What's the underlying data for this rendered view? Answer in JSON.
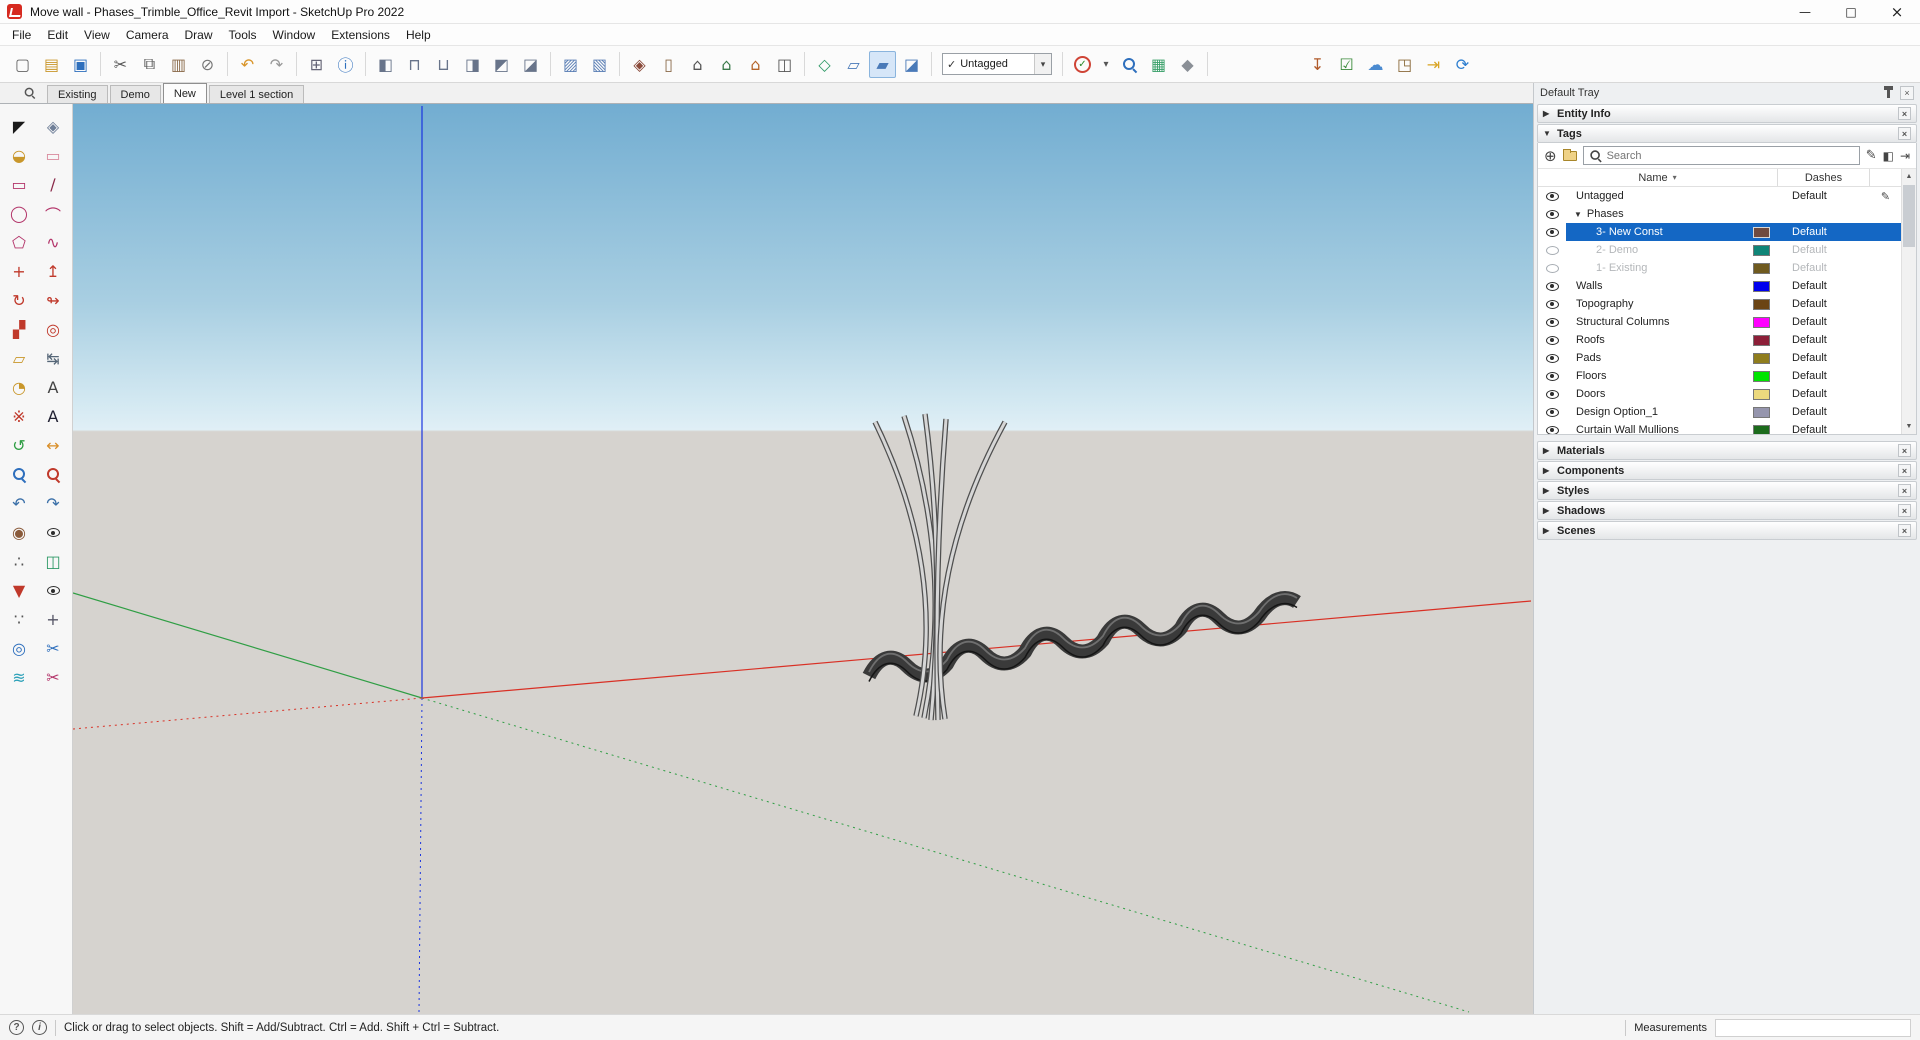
{
  "window": {
    "title": "Move wall - Phases_Trimble_Office_Revit Import - SketchUp Pro 2022"
  },
  "icons": {
    "minimize": "—",
    "maximize": "□",
    "window_close": "×",
    "collapsed_arrow": "▶",
    "expanded_arrow": "▼",
    "close": "×",
    "dropdown_arrow": "▾",
    "sort_chevron": "▾",
    "check": "✓",
    "pencil": "✎",
    "add": "⊕",
    "scroll_up": "▲",
    "scroll_down": "▼",
    "help": "?",
    "info": "i"
  },
  "menubar": {
    "items": [
      "File",
      "Edit",
      "View",
      "Camera",
      "Draw",
      "Tools",
      "Window",
      "Extensions",
      "Help"
    ]
  },
  "toolbar": {
    "tag_dropdown": {
      "value": "Untagged"
    },
    "groups": [
      [
        {
          "name": "new",
          "glyph": "▢",
          "color": "#666"
        },
        {
          "name": "open",
          "glyph": "▤",
          "color": "#c9972b"
        },
        {
          "name": "save",
          "glyph": "▣",
          "color": "#2e6fbd"
        }
      ],
      [
        {
          "name": "cut",
          "glyph": "✂",
          "color": "#555"
        },
        {
          "name": "copy",
          "glyph": "⧉",
          "color": "#555"
        },
        {
          "name": "paste",
          "glyph": "▥",
          "color": "#8a6a4a"
        },
        {
          "name": "erase",
          "glyph": "⊘",
          "color": "#777"
        }
      ],
      [
        {
          "name": "undo",
          "glyph": "↶",
          "color": "#d9952a"
        },
        {
          "name": "redo",
          "glyph": "↷",
          "color": "#999"
        }
      ],
      [
        {
          "name": "print",
          "glyph": "⊞",
          "color": "#667"
        },
        {
          "name": "model-info",
          "glyph": "ⓘ",
          "color": "#2e6fbd"
        }
      ],
      [
        {
          "name": "outer-shell",
          "glyph": "◧",
          "color": "#68748a"
        },
        {
          "name": "intersect",
          "glyph": "⊓",
          "color": "#68748a"
        },
        {
          "name": "union",
          "glyph": "⊔",
          "color": "#68748a"
        },
        {
          "name": "subtract",
          "glyph": "◨",
          "color": "#68748a"
        },
        {
          "name": "trim",
          "glyph": "◩",
          "color": "#68748a"
        },
        {
          "name": "split",
          "glyph": "◪",
          "color": "#68748a"
        }
      ],
      [
        {
          "name": "x-ray",
          "glyph": "▨",
          "color": "#5b7fb5"
        },
        {
          "name": "back-edges",
          "glyph": "▧",
          "color": "#5b7fb5"
        }
      ],
      [
        {
          "name": "component",
          "glyph": "◈",
          "color": "#8a4a3a"
        },
        {
          "name": "door",
          "glyph": "▯",
          "color": "#8a6a4a"
        },
        {
          "name": "home",
          "glyph": "⌂",
          "color": "#555"
        },
        {
          "name": "share-model",
          "glyph": "⌂",
          "color": "#3a7a4a"
        },
        {
          "name": "extension-warehouse",
          "glyph": "⌂",
          "color": "#b5652a"
        },
        {
          "name": "3d-warehouse",
          "glyph": "◫",
          "color": "#555"
        }
      ],
      [
        {
          "name": "section-plane",
          "glyph": "◇",
          "color": "#2f9a67"
        },
        {
          "name": "display-section-planes",
          "glyph": "▱",
          "color": "#4a7ab8"
        },
        {
          "name": "display-section-cuts",
          "glyph": "▰",
          "color": "#4a7ab8",
          "pressed": true
        },
        {
          "name": "display-section-fill",
          "glyph": "◪",
          "color": "#4a7ab8"
        }
      ],
      [
        {
          "type": "combo",
          "name": "tag-filter"
        }
      ],
      [
        {
          "type": "circle-check",
          "name": "check-validity"
        },
        {
          "name": "classifier-dropdown",
          "glyph": "▾",
          "color": "#555",
          "small": true
        },
        {
          "type": "mag",
          "name": "zoom-selection",
          "color": "#2e6fbd"
        },
        {
          "name": "generate-report",
          "glyph": "▦",
          "color": "#3aa06a"
        },
        {
          "name": "classifier-tag",
          "glyph": "◆",
          "color": "#8a8f96"
        }
      ],
      [
        {
          "name": "import",
          "glyph": "↧",
          "color": "#b05a2a"
        },
        {
          "name": "check-model",
          "glyph": "☑",
          "color": "#3a8a3a"
        },
        {
          "name": "publish-trimble-connect",
          "glyph": "☁",
          "color": "#4a8ad0"
        },
        {
          "name": "share-3d-warehouse",
          "glyph": "◳",
          "color": "#8a6a3a"
        },
        {
          "name": "send-to-layout",
          "glyph": "⇥",
          "color": "#d9a422"
        },
        {
          "name": "refresh-model",
          "glyph": "⟳",
          "color": "#2e7fd0"
        }
      ]
    ]
  },
  "scene_tabs": {
    "tabs": [
      {
        "label": "Existing",
        "active": false
      },
      {
        "label": "Demo",
        "active": false
      },
      {
        "label": "New",
        "active": true
      },
      {
        "label": "Level 1 section",
        "active": false
      }
    ]
  },
  "left_toolbar": {
    "tools": [
      {
        "name": "select",
        "glyph": "◤",
        "color": "#1a1a1a"
      },
      {
        "name": "make-component",
        "glyph": "◈",
        "color": "#6f7f98"
      },
      {
        "name": "paint-bucket",
        "glyph": "◒",
        "color": "#c9972b"
      },
      {
        "name": "eraser",
        "glyph": "▭",
        "color": "#d98a9d"
      },
      {
        "name": "rectangle",
        "glyph": "▭",
        "color": "#b3356a"
      },
      {
        "name": "line",
        "glyph": "∕",
        "color": "#8a2a4a"
      },
      {
        "name": "circle",
        "glyph": "◯",
        "color": "#b3356a"
      },
      {
        "name": "arc",
        "glyph": "⌒",
        "color": "#b3356a"
      },
      {
        "name": "polygon",
        "glyph": "⬠",
        "color": "#b3356a"
      },
      {
        "name": "freehand",
        "glyph": "∿",
        "color": "#b3356a"
      },
      {
        "name": "move",
        "glyph": "+",
        "color": "#c0392b"
      },
      {
        "name": "push-pull",
        "glyph": "↥",
        "color": "#c0392b"
      },
      {
        "name": "rotate",
        "glyph": "↻",
        "color": "#c0392b"
      },
      {
        "name": "follow-me",
        "glyph": "↬",
        "color": "#c0392b"
      },
      {
        "name": "scale",
        "glyph": "▞",
        "color": "#c0392b"
      },
      {
        "name": "offset",
        "glyph": "◎",
        "color": "#c0392b"
      },
      {
        "name": "tape-measure",
        "glyph": "▱",
        "color": "#c9972b"
      },
      {
        "name": "dimension",
        "glyph": "↹",
        "color": "#556677"
      },
      {
        "name": "protractor",
        "glyph": "◔",
        "color": "#c9972b"
      },
      {
        "name": "text",
        "glyph": "A",
        "color": "#444"
      },
      {
        "name": "axes",
        "glyph": "※",
        "color": "#c0392b"
      },
      {
        "name": "3d-text",
        "glyph": "A",
        "color": "#223"
      },
      {
        "name": "orbit",
        "glyph": "↺",
        "color": "#2f9e44"
      },
      {
        "name": "pan",
        "glyph": "↔",
        "color": "#d98f2a"
      },
      {
        "name": "zoom",
        "glyph": "@MAG",
        "color": "#2e6fbd"
      },
      {
        "name": "zoom-extents",
        "glyph": "@MAG",
        "color": "#c0392b"
      },
      {
        "name": "previous-view",
        "glyph": "↶",
        "color": "#3a6fa8"
      },
      {
        "name": "next-view",
        "glyph": "↷",
        "color": "#3a6fa8"
      },
      {
        "name": "position-camera",
        "gly ph": "",
        "glyph": "◉",
        "color": "#8a5a3a"
      },
      {
        "name": "look-around",
        "glyph": "@EYE",
        "color": "#333"
      },
      {
        "name": "walk",
        "glyph": "∴",
        "color": "#555"
      },
      {
        "name": "section-plane-tool",
        "glyph": "◫",
        "color": "#2f9a67"
      },
      {
        "name": "drop-pin",
        "glyph": "▼",
        "color": "#c0392b"
      },
      {
        "name": "view-eye",
        "glyph": "@EYE",
        "color": "#111"
      },
      {
        "name": "walk-feet",
        "glyph": "∵",
        "color": "#555"
      },
      {
        "name": "move-view",
        "glyph": "+",
        "color": "#556"
      },
      {
        "name": "solar-north",
        "glyph": "◎",
        "color": "#2e6fbd"
      },
      {
        "name": "split-tool",
        "glyph": "✂",
        "color": "#2e6fbd"
      },
      {
        "name": "layers-tool",
        "glyph": "≋",
        "color": "#2aa0b8"
      },
      {
        "name": "trim-tool",
        "glyph": "✂",
        "color": "#b3356a"
      }
    ]
  },
  "viewport": {
    "sky_top": "#72add1",
    "sky_horizon": "#e0eff6",
    "ground": "#d6d3cf",
    "axes_colors": {
      "red": "#d93025",
      "green": "#2f9e44",
      "blue": "#1a35e0"
    },
    "model": {
      "canopy": "#3a3a3a",
      "canopy_highlight": "#6f6f6f",
      "canopy_shadow": "#151515",
      "pole": "#d6d6d6",
      "pole_outline": "#4f4f4f"
    }
  },
  "tray": {
    "title": "Default Tray",
    "panels_top": [
      {
        "label": "Entity Info"
      },
      {
        "label": "Tags"
      }
    ],
    "tags": {
      "search_placeholder": "Search",
      "columns": {
        "name": "Name",
        "dashes": "Dashes"
      },
      "rows": [
        {
          "name": "Untagged",
          "dashes": "Default",
          "visible": true,
          "level": 0,
          "pencil": true
        },
        {
          "name": "Phases",
          "type": "folder",
          "expanded": true,
          "visible": true,
          "level": 0
        },
        {
          "name": "3- New Const",
          "dashes": "Default",
          "visible": true,
          "level": 1,
          "swatch": "#6f4a3f",
          "selected": true
        },
        {
          "name": "2- Demo",
          "dashes": "Default",
          "visible": false,
          "level": 1,
          "swatch": "#0f8577",
          "dimmed": true
        },
        {
          "name": "1- Existing",
          "dashes": "Default",
          "visible": false,
          "level": 1,
          "swatch": "#6f5a1f",
          "dimmed": true
        },
        {
          "name": "Walls",
          "dashes": "Default",
          "visible": true,
          "level": 0,
          "swatch": "#0000ee"
        },
        {
          "name": "Topography",
          "dashes": "Default",
          "visible": true,
          "level": 0,
          "swatch": "#6b4414"
        },
        {
          "name": "Structural Columns",
          "dashes": "Default",
          "visible": true,
          "level": 0,
          "swatch": "#ff00ff"
        },
        {
          "name": "Roofs",
          "dashes": "Default",
          "visible": true,
          "level": 0,
          "swatch": "#8c1f38"
        },
        {
          "name": "Pads",
          "dashes": "Default",
          "visible": true,
          "level": 0,
          "swatch": "#8f7d1d"
        },
        {
          "name": "Floors",
          "dashes": "Default",
          "visible": true,
          "level": 0,
          "swatch": "#00e400"
        },
        {
          "name": "Doors",
          "dashes": "Default",
          "visible": true,
          "level": 0,
          "swatch": "#ecd97e"
        },
        {
          "name": "Design Option_1",
          "dashes": "Default",
          "visible": true,
          "level": 0,
          "swatch": "#9595ad"
        },
        {
          "name": "Curtain Wall Mullions",
          "dashes": "Default",
          "visible": true,
          "level": 0,
          "swatch": "#1c6b1c"
        }
      ]
    },
    "panels_bottom": [
      {
        "label": "Materials"
      },
      {
        "label": "Components"
      },
      {
        "label": "Styles"
      },
      {
        "label": "Shadows"
      },
      {
        "label": "Scenes"
      }
    ]
  },
  "statusbar": {
    "hint": "Click or drag to select objects. Shift = Add/Subtract. Ctrl = Add. Shift + Ctrl = Subtract.",
    "measurements_label": "Measurements",
    "measurements_value": ""
  }
}
